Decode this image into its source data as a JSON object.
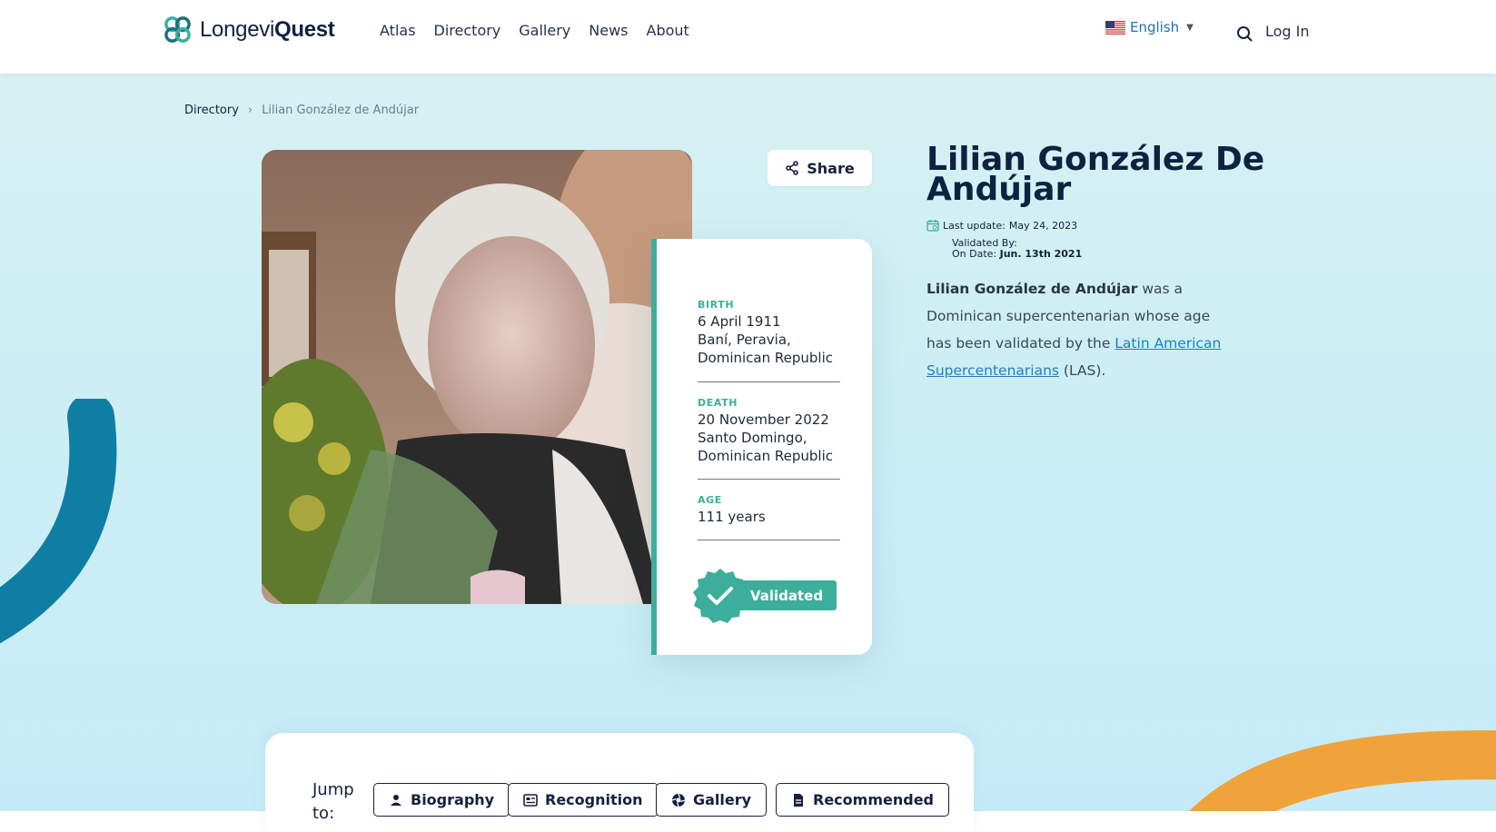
{
  "header": {
    "logo_text_light": "Longevi",
    "logo_text_bold": "Quest",
    "nav": [
      "Atlas",
      "Directory",
      "Gallery",
      "News",
      "About"
    ],
    "language": "English",
    "login": "Log In"
  },
  "breadcrumb": {
    "parent": "Directory",
    "current": "Lilian González de Andújar"
  },
  "share_label": "Share",
  "profile": {
    "name": "Lilian González De Andújar",
    "last_update_label": "Last update:",
    "last_update": "May 24, 2023",
    "validated_by_label": "Validated By:",
    "on_date_label": "On Date:",
    "on_date": "Jun. 13th 2021",
    "description_bold": "Lilian González de Andújar",
    "description_text": " was a Dominican supercentenarian whose age has been validated by the ",
    "description_link": "Latin American Supercentenarians",
    "description_end": " (LAS)."
  },
  "info": {
    "birth_label": "BIRTH",
    "birth_date": "6 April 1911",
    "birth_place": "Baní, Peravia, Dominican Republic",
    "death_label": "DEATH",
    "death_date": "20 November 2022",
    "death_place": "Santo Domingo, Dominican Republic",
    "age_label": "AGE",
    "age_value": "111 years",
    "validated_label": "Validated"
  },
  "jump": {
    "label": "Jump to:",
    "buttons": [
      "Biography",
      "Recognition",
      "Gallery",
      "Recommended"
    ]
  },
  "colors": {
    "accent": "#3dae9c",
    "navy": "#0c2340",
    "link": "#1f7fc4",
    "deco_blue": "#0f7ea3",
    "deco_orange": "#f0a33a"
  }
}
